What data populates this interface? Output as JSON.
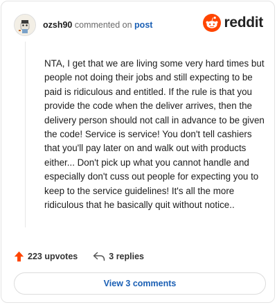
{
  "header": {
    "username": "ozsh90",
    "commented_on": "commented on",
    "post_link": "post",
    "brand_name": "reddit"
  },
  "comment": {
    "text": "NTA, I get that we are living some very hard times but people not doing their jobs and still expecting to be paid is ridiculous and entitled. If the rule is that you provide the code when the deliver arrives, then the delivery person should not call in advance to be given the code! Service is service! You don't tell cashiers that you'll pay later on and walk out with products either... Don't pick up what you cannot handle and especially don't cuss out people for expecting you to keep to the service guidelines! It's all the more ridiculous that he basically quit without notice.."
  },
  "actions": {
    "upvotes": "223 upvotes",
    "replies": "3 replies"
  },
  "footer": {
    "view_comments": "View 3 comments"
  },
  "icons": {
    "upvote": "upvote-arrow-icon",
    "reply": "reply-arrow-icon",
    "brand": "reddit-snoo-icon",
    "avatar": "user-avatar"
  },
  "colors": {
    "accent": "#1a5fb4",
    "upvote": "#ff4500",
    "brand": "#ff4500"
  }
}
